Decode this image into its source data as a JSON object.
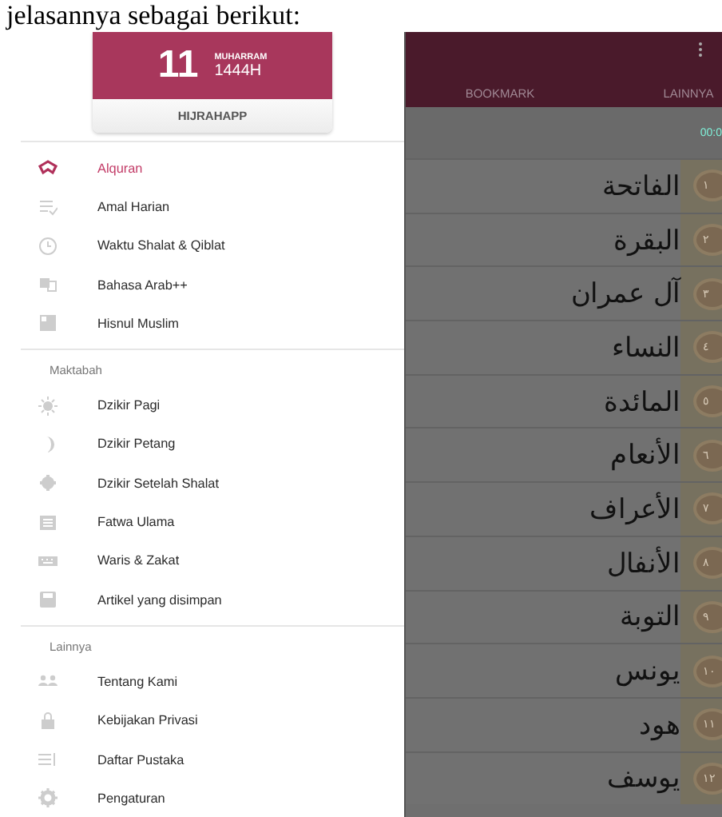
{
  "caption": "jelasannya sebagai berikut:",
  "calendar": {
    "day": "11",
    "month": "MUHARRAM",
    "year": "1444H",
    "app_name": "HIJRAHAPP"
  },
  "drawer": {
    "sections": [
      {
        "items": [
          {
            "label": "Alquran",
            "selected": true
          },
          {
            "label": "Amal Harian",
            "selected": false
          },
          {
            "label": "Waktu Shalat & Qiblat",
            "selected": false
          },
          {
            "label": "Bahasa Arab++",
            "selected": false
          },
          {
            "label": "Hisnul Muslim",
            "selected": false
          }
        ]
      },
      {
        "heading": "Maktabah",
        "items": [
          {
            "label": "Dzikir Pagi",
            "selected": false
          },
          {
            "label": "Dzikir Petang",
            "selected": false
          },
          {
            "label": "Dzikir Setelah Shalat",
            "selected": false
          },
          {
            "label": "Fatwa Ulama",
            "selected": false
          },
          {
            "label": "Waris & Zakat",
            "selected": false
          },
          {
            "label": "Artikel yang disimpan",
            "selected": false
          }
        ]
      },
      {
        "heading": "Lainnya",
        "items": [
          {
            "label": "Tentang Kami",
            "selected": false
          },
          {
            "label": "Kebijakan Privasi",
            "selected": false
          },
          {
            "label": "Daftar Pustaka",
            "selected": false
          },
          {
            "label": "Pengaturan",
            "selected": false
          }
        ]
      }
    ]
  },
  "app_bar": {
    "left_tab": "BOOKMARK",
    "right_tab": "LAINNYA"
  },
  "time": "00:0",
  "surahs": [
    {
      "number": "١",
      "name": "الفاتحة"
    },
    {
      "number": "٢",
      "name": "البقرة"
    },
    {
      "number": "٣",
      "name": "آل عمران"
    },
    {
      "number": "٤",
      "name": "النساء"
    },
    {
      "number": "٥",
      "name": "المائدة"
    },
    {
      "number": "٦",
      "name": "الأنعام"
    },
    {
      "number": "٧",
      "name": "الأعراف"
    },
    {
      "number": "٨",
      "name": "الأنفال"
    },
    {
      "number": "٩",
      "name": "التوبة"
    },
    {
      "number": "١٠",
      "name": "يونس"
    },
    {
      "number": "١١",
      "name": "هود"
    },
    {
      "number": "١٢",
      "name": "يوسف"
    }
  ]
}
